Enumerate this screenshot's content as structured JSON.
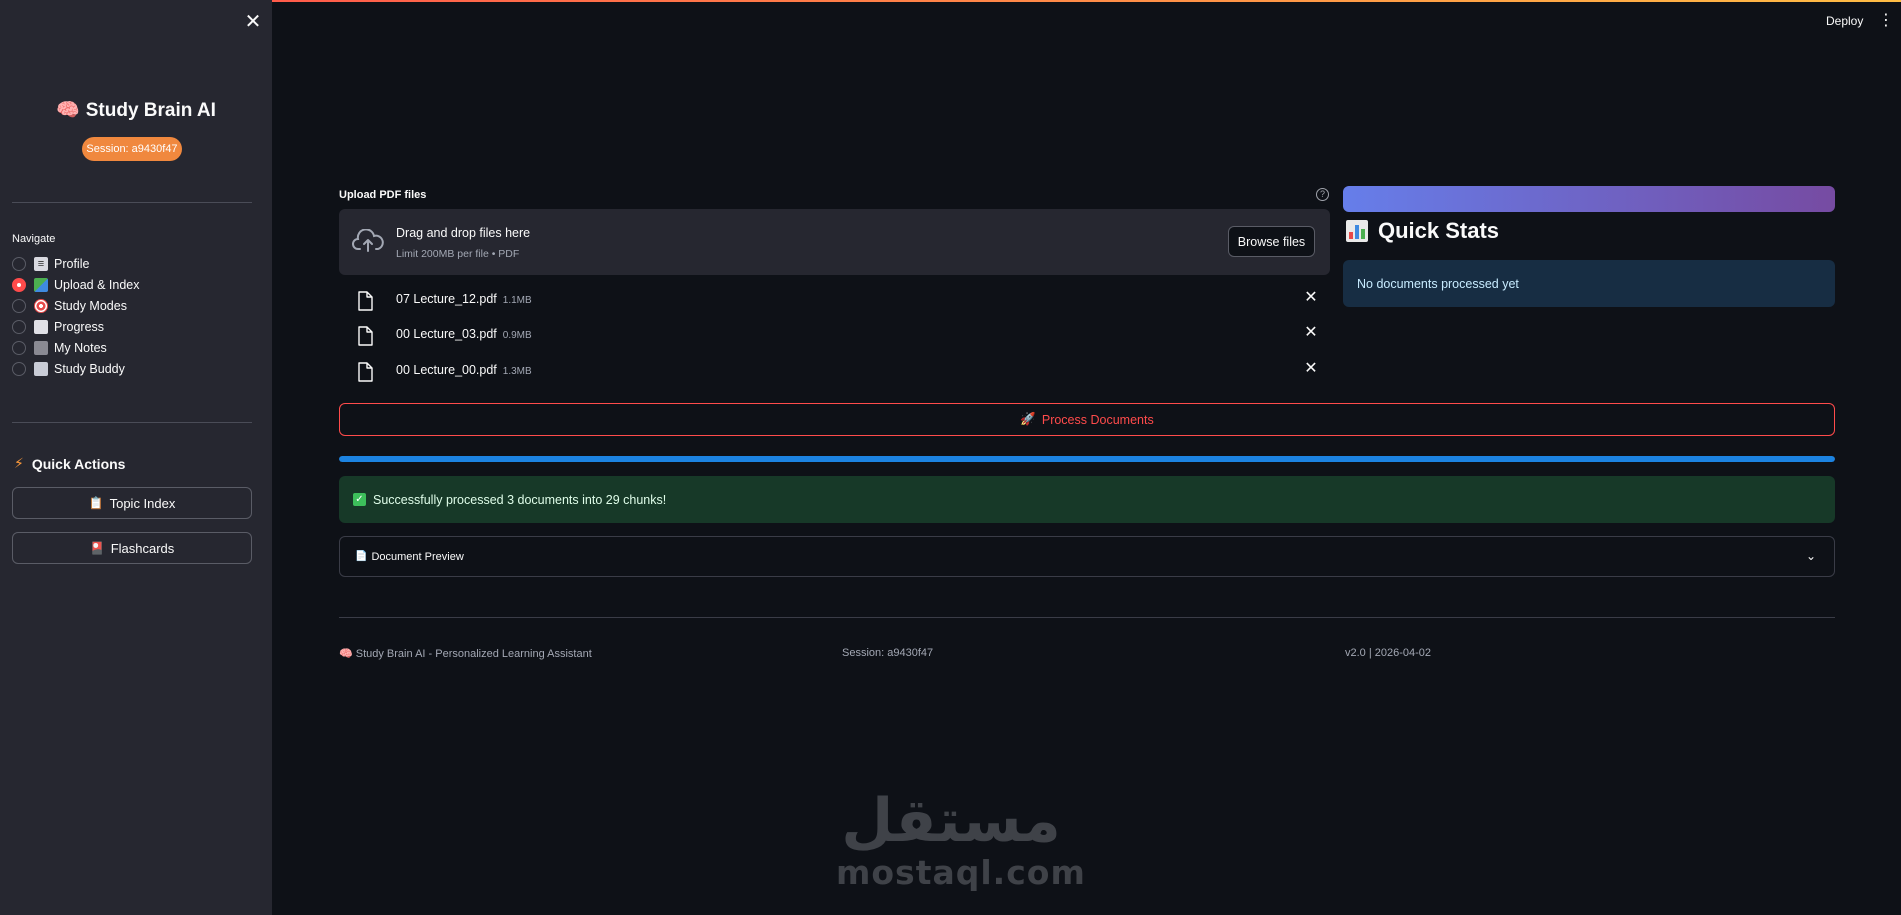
{
  "sidebar": {
    "app_title": "Study Brain AI",
    "session_badge": "Session: a9430f47",
    "nav_label": "Navigate",
    "nav_items": [
      {
        "label": "Profile",
        "selected": false
      },
      {
        "label": "Upload & Index",
        "selected": true
      },
      {
        "label": "Study Modes",
        "selected": false
      },
      {
        "label": "Progress",
        "selected": false
      },
      {
        "label": "My Notes",
        "selected": false
      },
      {
        "label": "Study Buddy",
        "selected": false
      }
    ],
    "quick_actions_title": "Quick Actions",
    "topic_index_label": "Topic Index",
    "flashcards_label": "Flashcards"
  },
  "header": {
    "deploy_label": "Deploy"
  },
  "uploader": {
    "label": "Upload PDF files",
    "drop_title": "Drag and drop files here",
    "drop_sub": "Limit 200MB per file • PDF",
    "browse_label": "Browse files",
    "files": [
      {
        "name": "07 Lecture_12.pdf",
        "size": "1.1MB"
      },
      {
        "name": "00 Lecture_03.pdf",
        "size": "0.9MB"
      },
      {
        "name": "00 Lecture_00.pdf",
        "size": "1.3MB"
      }
    ]
  },
  "process_label": "Process Documents",
  "progress": {
    "value": 1.0,
    "color": "#1c83e1"
  },
  "success_message": "Successfully processed 3 documents into 29 chunks!",
  "expander_label": "Document Preview",
  "quick_stats": {
    "title": "Quick Stats",
    "info": "No documents processed yet"
  },
  "footer": {
    "left": "🧠 Study Brain AI - Personalized Learning Assistant",
    "center": "Session: a9430f47",
    "right": "v2.0 | 2026-04-02"
  },
  "watermark": {
    "arabic": "مستقل",
    "latin": "mostaql.com"
  },
  "colors": {
    "accent": "#ff4b4b",
    "session_badge": "#f0883e",
    "success_bg": "#173928",
    "info_bg": "#172d43"
  }
}
